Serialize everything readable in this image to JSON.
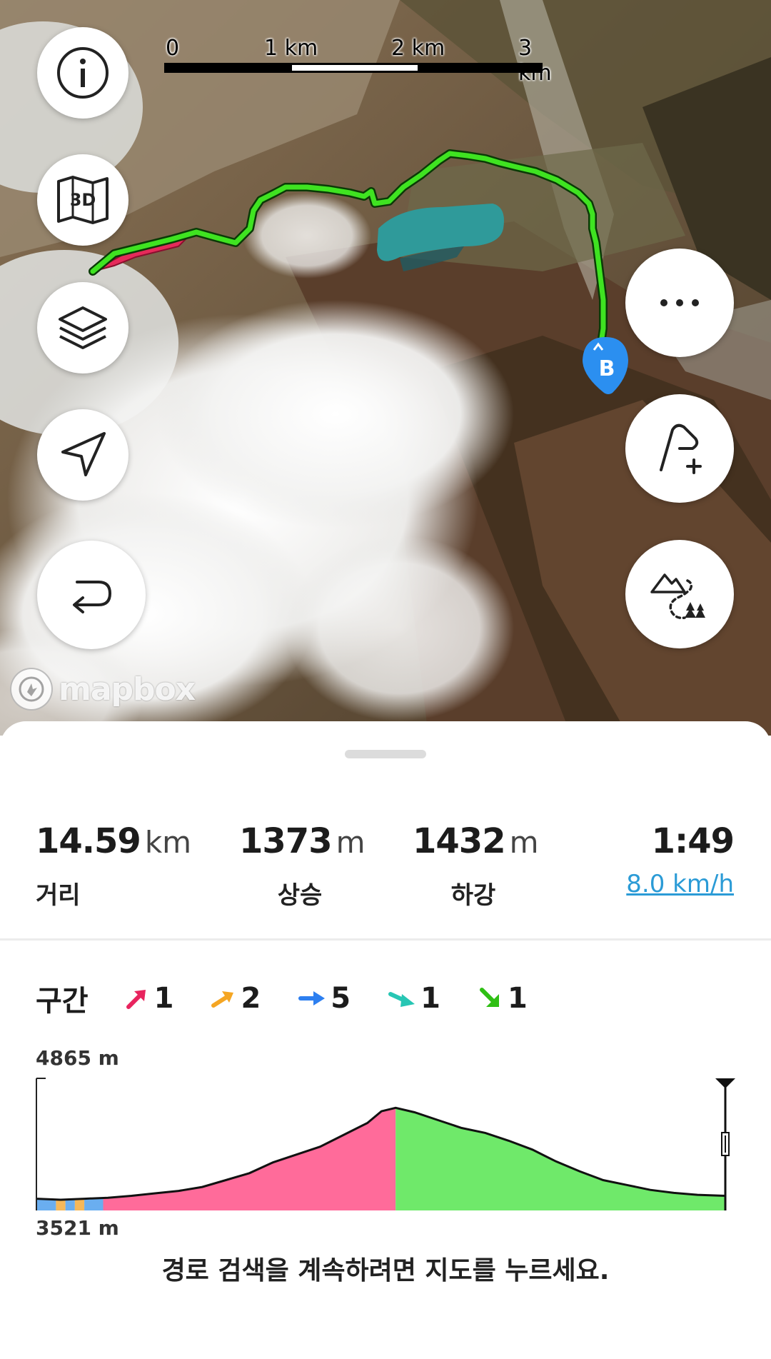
{
  "scale": {
    "labels": [
      "0",
      "1 km",
      "2 km",
      "3 km"
    ]
  },
  "map_controls": {
    "left": [
      {
        "name": "info-button",
        "icon": "info-icon"
      },
      {
        "name": "3d-map-button",
        "icon": "3d-map-icon",
        "label": "3D"
      },
      {
        "name": "layers-button",
        "icon": "layers-icon"
      },
      {
        "name": "locate-button",
        "icon": "navigation-arrow-icon"
      },
      {
        "name": "reverse-route-button",
        "icon": "u-turn-icon"
      }
    ],
    "right": [
      {
        "name": "more-button",
        "icon": "more-dots-icon"
      },
      {
        "name": "add-waypoint-button",
        "icon": "route-plus-icon"
      },
      {
        "name": "outdoor-pois-button",
        "icon": "mountain-trees-icon"
      }
    ]
  },
  "map_marker": {
    "label": "B"
  },
  "attribution": {
    "label": "mapbox"
  },
  "stats": {
    "distance": {
      "value": "14.59",
      "unit": "km",
      "label": "거리"
    },
    "ascent": {
      "value": "1373",
      "unit": "m",
      "label": "상승"
    },
    "descent": {
      "value": "1432",
      "unit": "m",
      "label": "하강"
    },
    "time": {
      "value": "1:49",
      "speed": "8.0 km/h"
    }
  },
  "segments": {
    "title": "구간",
    "items": [
      {
        "color": "#e8245e",
        "direction": "up-steep",
        "count": "1"
      },
      {
        "color": "#f5a623",
        "direction": "up",
        "count": "2"
      },
      {
        "color": "#2d7ff0",
        "direction": "flat",
        "count": "5"
      },
      {
        "color": "#27c6b4",
        "direction": "down",
        "count": "1"
      },
      {
        "color": "#2fbf14",
        "direction": "down-steep",
        "count": "1"
      }
    ]
  },
  "chart_data": {
    "type": "area",
    "title": "",
    "xlabel": "",
    "ylabel": "",
    "x_unit": "km",
    "xlim": [
      0,
      14.59
    ],
    "ylim": [
      3521,
      4865
    ],
    "y_labels": [
      "4865 m",
      "3521 m"
    ],
    "x": [
      0,
      0.5,
      1.0,
      1.5,
      2.0,
      2.5,
      3.0,
      3.5,
      4.0,
      4.5,
      5.0,
      5.5,
      6.0,
      6.5,
      7.0,
      7.3,
      7.6,
      8.0,
      8.5,
      9.0,
      9.5,
      10.0,
      10.5,
      11.0,
      11.5,
      12.0,
      12.5,
      13.0,
      13.5,
      14.0,
      14.59
    ],
    "y": [
      3640,
      3630,
      3640,
      3650,
      3670,
      3695,
      3720,
      3760,
      3830,
      3900,
      4010,
      4090,
      4170,
      4290,
      4410,
      4530,
      4565,
      4520,
      4440,
      4360,
      4310,
      4230,
      4140,
      4020,
      3920,
      3830,
      3780,
      3730,
      3700,
      3680,
      3670
    ],
    "segments": [
      {
        "from": 0,
        "to": 0.4,
        "color": "#6aaef0"
      },
      {
        "from": 0.4,
        "to": 0.6,
        "color": "#f5b85a"
      },
      {
        "from": 0.6,
        "to": 0.8,
        "color": "#6aaef0"
      },
      {
        "from": 0.8,
        "to": 1.0,
        "color": "#f5b85a"
      },
      {
        "from": 1.0,
        "to": 1.4,
        "color": "#6aaef0"
      },
      {
        "from": 1.4,
        "to": 7.6,
        "color": "#ff6b9a"
      },
      {
        "from": 7.6,
        "to": 14.59,
        "color": "#6fe96a"
      }
    ]
  },
  "hint": "경로 검색을 계속하려면 지도를 누르세요."
}
